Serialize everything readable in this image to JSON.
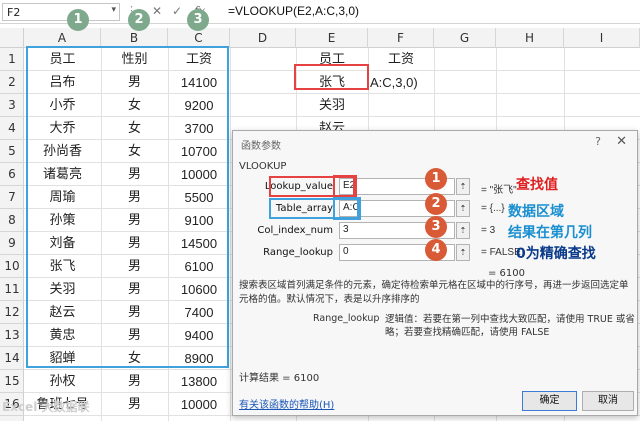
{
  "formula_bar": {
    "name_box": "F2",
    "dots": "⋮",
    "cancel_symbol": "✕",
    "enter_symbol": "✓",
    "fx_label": "fx",
    "formula": "=VLOOKUP(E2,A:C,3,0)"
  },
  "columns": [
    "A",
    "B",
    "C",
    "D",
    "E",
    "F",
    "G",
    "H",
    "I"
  ],
  "rows": [
    "1",
    "2",
    "3",
    "4",
    "5",
    "6",
    "7",
    "8",
    "9",
    "10",
    "11",
    "12",
    "13",
    "14",
    "15",
    "16"
  ],
  "table": {
    "headers": [
      "员工",
      "性别",
      "工资"
    ],
    "records": [
      [
        "吕布",
        "男",
        "14100"
      ],
      [
        "小乔",
        "女",
        "9200"
      ],
      [
        "大乔",
        "女",
        "3700"
      ],
      [
        "孙尚香",
        "女",
        "10700"
      ],
      [
        "诸葛亮",
        "男",
        "10000"
      ],
      [
        "周瑜",
        "男",
        "5500"
      ],
      [
        "孙策",
        "男",
        "9100"
      ],
      [
        "刘备",
        "男",
        "14500"
      ],
      [
        "张飞",
        "男",
        "6100"
      ],
      [
        "关羽",
        "男",
        "10600"
      ],
      [
        "赵云",
        "男",
        "7400"
      ],
      [
        "黄忠",
        "男",
        "9400"
      ],
      [
        "貂蝉",
        "女",
        "8900"
      ],
      [
        "孙权",
        "男",
        "13800"
      ],
      [
        "鲁班七号",
        "男",
        "10000"
      ]
    ]
  },
  "lookup": {
    "header_e": "员工",
    "header_f": "工资",
    "e_values": [
      "张飞",
      "关羽",
      "赵云"
    ],
    "f2_text": "A:C,3,0)"
  },
  "badges": [
    "1",
    "2",
    "3",
    "4"
  ],
  "dialog": {
    "title": "函数参数",
    "help_q": "?",
    "close": "✕",
    "function_name": "VLOOKUP",
    "args": [
      {
        "label": "Lookup_value",
        "value": "E2",
        "result": "= \"张飞\""
      },
      {
        "label": "Table_array",
        "value": "A:C",
        "result": "= {...}"
      },
      {
        "label": "Col_index_num",
        "value": "3",
        "result": "= 3"
      },
      {
        "label": "Range_lookup",
        "value": "0",
        "result": "= FALSE"
      }
    ],
    "result_line": "= 6100",
    "description": "搜索表区域首列满足条件的元素，确定待检索单元格在区域中的行序号，再进一步返回选定单元格的值。默认情况下，表是以升序排序的",
    "param_name": "Range_lookup",
    "param_desc": "逻辑值：若要在第一列中查找大致匹配，请使用 TRUE 或省略；若要查找精确匹配，请使用 FALSE",
    "calc_result": "计算结果 =    6100",
    "help_link": "有关该函数的帮助(H)",
    "ok": "确定",
    "cancel": "取消"
  },
  "annotations": {
    "a1": "查找值",
    "a2": "数据区域",
    "a3": "结果在第几列",
    "a4": "0为精确查找",
    "colors": {
      "red": "#e02020",
      "teal": "#1a8fd0",
      "navy": "#0a3a8a"
    }
  },
  "watermark": "Excel 大数据联"
}
